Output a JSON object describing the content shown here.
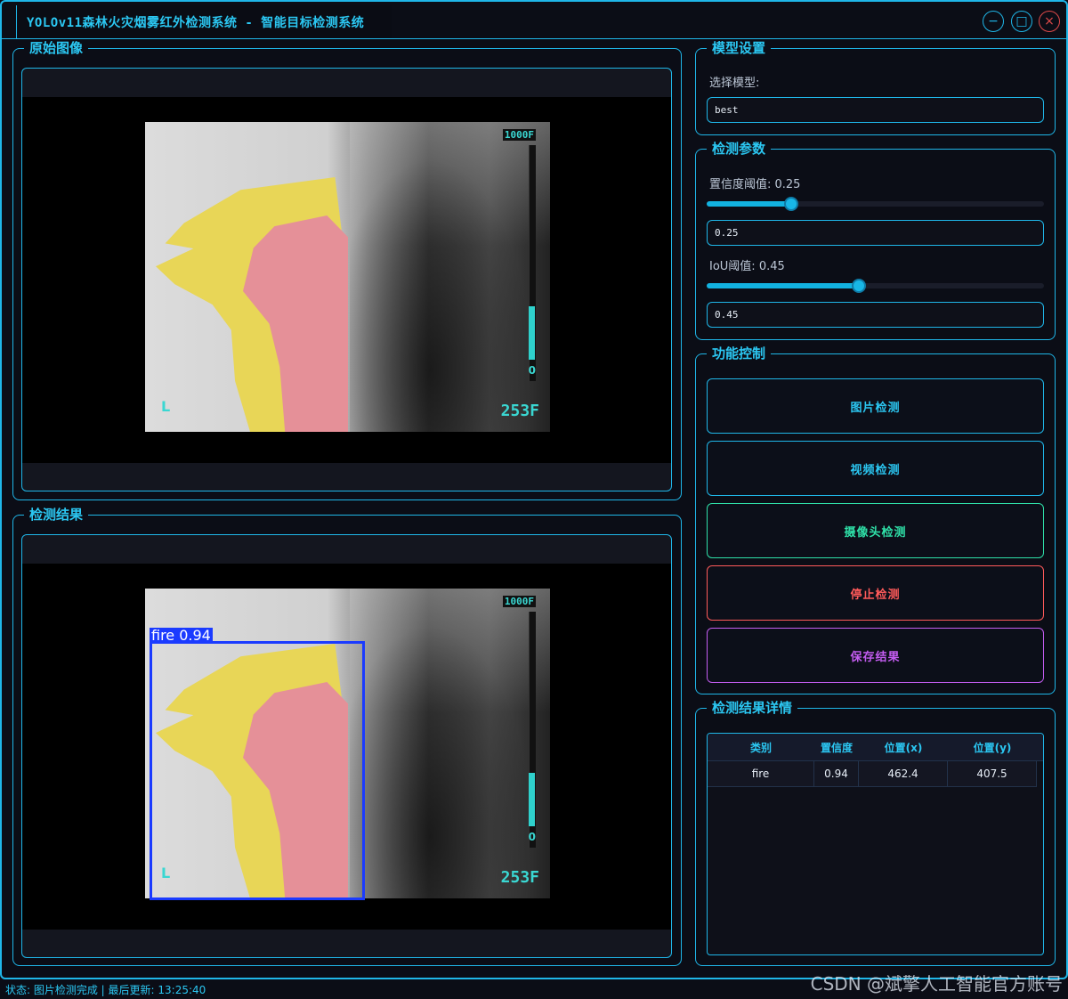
{
  "window": {
    "title": "YOLOv11森林火灾烟雾红外检测系统 - 智能目标检测系统",
    "minimize_glyph": "−",
    "maximize_glyph": "□",
    "close_glyph": "×"
  },
  "original_panel": {
    "title": "原始图像",
    "image": {
      "max_temp": "1000F",
      "min_temp": "253F",
      "scale_zero": "0",
      "corner_mark": "L"
    }
  },
  "result_panel": {
    "title": "检测结果",
    "image": {
      "max_temp": "1000F",
      "min_temp": "253F",
      "scale_zero": "0",
      "corner_mark": "L"
    },
    "detection_label": "fire  0.94"
  },
  "model_settings": {
    "title": "模型设置",
    "select_label": "选择模型:",
    "selected_model": "best"
  },
  "detection_params": {
    "title": "检测参数",
    "confidence_label": "置信度阈值: 0.25",
    "confidence_value": 0.25,
    "confidence_input": "0.25",
    "iou_label": "IoU阈值: 0.45",
    "iou_value": 0.45,
    "iou_input": "0.45"
  },
  "function_control": {
    "title": "功能控制",
    "buttons": [
      {
        "label": "图片检测",
        "color": "#2bc7f2"
      },
      {
        "label": "视频检测",
        "color": "#2bc7f2"
      },
      {
        "label": "摄像头检测",
        "color": "#2fe0a8"
      },
      {
        "label": "停止检测",
        "color": "#ff5a5a"
      },
      {
        "label": "保存结果",
        "color": "#c35cf0"
      }
    ]
  },
  "results_detail": {
    "title": "检测结果详情",
    "columns": [
      "类别",
      "置信度",
      "位置(x)",
      "位置(y)"
    ],
    "rows": [
      [
        "fire",
        "0.94",
        "462.4",
        "407.5"
      ]
    ]
  },
  "statusbar": {
    "text": "状态: 图片检测完成 | 最后更新: 13:25:40"
  },
  "watermark": "CSDN @斌擎人工智能官方账号",
  "colors": {
    "accent": "#1fb6e8",
    "background": "#0b0d16",
    "bbox": "#1b3bff"
  }
}
